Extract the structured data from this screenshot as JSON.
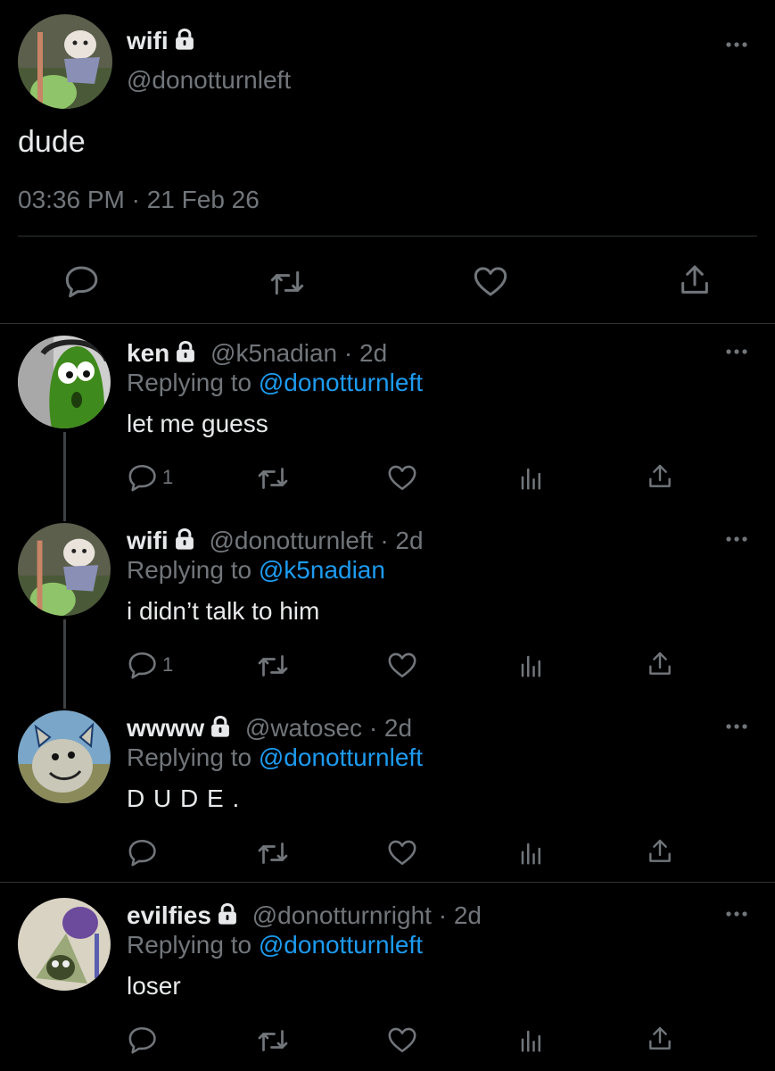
{
  "main_tweet": {
    "display_name": "wifi",
    "handle": "@donotturnleft",
    "text": "dude",
    "timestamp": "03:36 PM · 21 Feb 26"
  },
  "replies": [
    {
      "display_name": "ken",
      "handle": "@k5nadian",
      "age": "· 2d",
      "replying_prefix": "Replying to",
      "replying_to": "@donotturnleft",
      "text": "let me guess",
      "reply_count": "1"
    },
    {
      "display_name": "wifi",
      "handle": "@donotturnleft",
      "age": "· 2d",
      "replying_prefix": "Replying to",
      "replying_to": "@k5nadian",
      "text": "i didn’t talk to him",
      "reply_count": "1"
    },
    {
      "display_name": "wwww",
      "handle": "@watosec",
      "age": "· 2d",
      "replying_prefix": "Replying to",
      "replying_to": "@donotturnleft",
      "text": "D U D E .",
      "reply_count": ""
    },
    {
      "display_name": "evilfies",
      "handle": "@donotturnright",
      "age": "· 2d",
      "replying_prefix": "Replying to",
      "replying_to": "@donotturnleft",
      "text": "loser",
      "reply_count": ""
    }
  ],
  "icons": [
    "lock-icon",
    "more-icon",
    "reply-icon",
    "retweet-icon",
    "like-icon",
    "analytics-icon",
    "share-icon"
  ],
  "colors": {
    "background": "#000000",
    "text": "#e7e9ea",
    "muted": "#71767b",
    "link": "#1d9bf0",
    "divider": "#2f3336"
  }
}
